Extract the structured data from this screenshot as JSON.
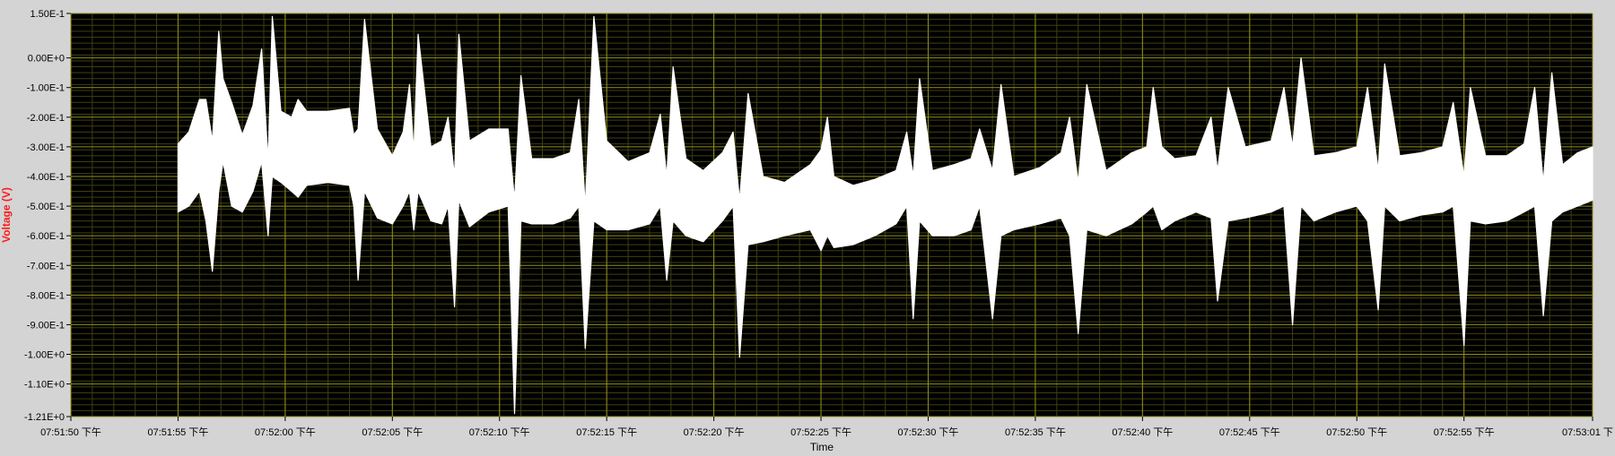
{
  "colors": {
    "background": "#d4d4d4",
    "plot_bg": "#000000",
    "major_grid": "#8f8f1e",
    "minor_grid": "#3f3f12",
    "trace": "#ffffff",
    "ylabel": "#ff1a1a",
    "tick_text": "#000000"
  },
  "chart_data": {
    "type": "line",
    "title": "",
    "xlabel": "Time",
    "ylabel": "Voltage (V)",
    "grid": true,
    "legend": "none",
    "xlim": [
      "07:51:50",
      "07:53:01"
    ],
    "ylim": [
      -1.21,
      0.15
    ],
    "xtick_labels": [
      "07:51:50 下午",
      "07:51:55 下午",
      "07:52:00 下午",
      "07:52:05 下午",
      "07:52:10 下午",
      "07:52:15 下午",
      "07:52:20 下午",
      "07:52:25 下午",
      "07:52:30 下午",
      "07:52:35 下午",
      "07:52:40 下午",
      "07:52:45 下午",
      "07:52:50 下午",
      "07:52:55 下午",
      "07:53:01 下"
    ],
    "ytick_labels": [
      "1.50E-1",
      "0.00E+0",
      "-1.00E-1",
      "-2.00E-1",
      "-3.00E-1",
      "-4.00E-1",
      "-5.00E-1",
      "-6.00E-1",
      "-7.00E-1",
      "-8.00E-1",
      "-9.00E-1",
      "-1.00E+0",
      "-1.10E+0",
      "-1.21E+0"
    ],
    "ytick_values": [
      0.15,
      0.0,
      -0.1,
      -0.2,
      -0.3,
      -0.4,
      -0.5,
      -0.6,
      -0.7,
      -0.8,
      -0.9,
      -1.0,
      -1.1,
      -1.21
    ],
    "series": [
      {
        "band": [
          {
            "t": "07:51:55.0",
            "lo": -0.52,
            "hi": -0.29
          },
          {
            "t": "07:51:55.5",
            "lo": -0.5,
            "hi": -0.25
          },
          {
            "t": "07:51:56.0",
            "lo": -0.45,
            "hi": -0.14
          },
          {
            "t": "07:51:56.3",
            "lo": -0.55,
            "hi": -0.14
          },
          {
            "t": "07:51:56.6",
            "lo": -0.72,
            "hi": -0.28
          },
          {
            "t": "07:51:56.9",
            "lo": -0.45,
            "hi": 0.09
          },
          {
            "t": "07:51:57.1",
            "lo": -0.35,
            "hi": -0.07
          },
          {
            "t": "07:51:57.5",
            "lo": -0.5,
            "hi": -0.15
          },
          {
            "t": "07:51:58.0",
            "lo": -0.52,
            "hi": -0.26
          },
          {
            "t": "07:51:58.5",
            "lo": -0.45,
            "hi": -0.16
          },
          {
            "t": "07:51:58.9",
            "lo": -0.35,
            "hi": 0.03
          },
          {
            "t": "07:51:59.2",
            "lo": -0.6,
            "hi": -0.35
          },
          {
            "t": "07:51:59.4",
            "lo": -0.4,
            "hi": 0.14
          },
          {
            "t": "07:51:59.8",
            "lo": -0.42,
            "hi": -0.18
          },
          {
            "t": "07:52:00.3",
            "lo": -0.45,
            "hi": -0.2
          },
          {
            "t": "07:52:00.6",
            "lo": -0.47,
            "hi": -0.14
          },
          {
            "t": "07:52:01.0",
            "lo": -0.43,
            "hi": -0.18
          },
          {
            "t": "07:52:02.0",
            "lo": -0.42,
            "hi": -0.18
          },
          {
            "t": "07:52:03.0",
            "lo": -0.43,
            "hi": -0.17
          },
          {
            "t": "07:52:03.2",
            "lo": -0.5,
            "hi": -0.26
          },
          {
            "t": "07:52:03.4",
            "lo": -0.75,
            "hi": -0.24
          },
          {
            "t": "07:52:03.7",
            "lo": -0.45,
            "hi": 0.13
          },
          {
            "t": "07:52:04.3",
            "lo": -0.54,
            "hi": -0.24
          },
          {
            "t": "07:52:05.0",
            "lo": -0.56,
            "hi": -0.33
          },
          {
            "t": "07:52:05.5",
            "lo": -0.5,
            "hi": -0.25
          },
          {
            "t": "07:52:05.8",
            "lo": -0.45,
            "hi": -0.09
          },
          {
            "t": "07:52:06.0",
            "lo": -0.58,
            "hi": -0.32
          },
          {
            "t": "07:52:06.2",
            "lo": -0.45,
            "hi": 0.08
          },
          {
            "t": "07:52:06.8",
            "lo": -0.55,
            "hi": -0.3
          },
          {
            "t": "07:52:07.3",
            "lo": -0.56,
            "hi": -0.28
          },
          {
            "t": "07:52:07.6",
            "lo": -0.5,
            "hi": -0.2
          },
          {
            "t": "07:52:07.9",
            "lo": -0.84,
            "hi": -0.4
          },
          {
            "t": "07:52:08.1",
            "lo": -0.48,
            "hi": 0.08
          },
          {
            "t": "07:52:08.6",
            "lo": -0.57,
            "hi": -0.28
          },
          {
            "t": "07:52:09.5",
            "lo": -0.52,
            "hi": -0.24
          },
          {
            "t": "07:52:10.4",
            "lo": -0.5,
            "hi": -0.24
          },
          {
            "t": "07:52:10.7",
            "lo": -1.2,
            "hi": -0.48
          },
          {
            "t": "07:52:11.0",
            "lo": -0.55,
            "hi": -0.06
          },
          {
            "t": "07:52:11.5",
            "lo": -0.56,
            "hi": -0.34
          },
          {
            "t": "07:52:12.5",
            "lo": -0.56,
            "hi": -0.34
          },
          {
            "t": "07:52:13.3",
            "lo": -0.54,
            "hi": -0.32
          },
          {
            "t": "07:52:13.7",
            "lo": -0.5,
            "hi": -0.14
          },
          {
            "t": "07:52:14.0",
            "lo": -0.98,
            "hi": -0.5
          },
          {
            "t": "07:52:14.4",
            "lo": -0.55,
            "hi": 0.14
          },
          {
            "t": "07:52:15.0",
            "lo": -0.58,
            "hi": -0.28
          },
          {
            "t": "07:52:16.0",
            "lo": -0.58,
            "hi": -0.35
          },
          {
            "t": "07:52:17.0",
            "lo": -0.56,
            "hi": -0.32
          },
          {
            "t": "07:52:17.5",
            "lo": -0.5,
            "hi": -0.19
          },
          {
            "t": "07:52:17.8",
            "lo": -0.75,
            "hi": -0.4
          },
          {
            "t": "07:52:18.1",
            "lo": -0.55,
            "hi": -0.03
          },
          {
            "t": "07:52:18.7",
            "lo": -0.6,
            "hi": -0.34
          },
          {
            "t": "07:52:19.5",
            "lo": -0.62,
            "hi": -0.38
          },
          {
            "t": "07:52:20.4",
            "lo": -0.55,
            "hi": -0.32
          },
          {
            "t": "07:52:20.9",
            "lo": -0.5,
            "hi": -0.25
          },
          {
            "t": "07:52:21.2",
            "lo": -1.01,
            "hi": -0.48
          },
          {
            "t": "07:52:21.6",
            "lo": -0.63,
            "hi": -0.12
          },
          {
            "t": "07:52:22.3",
            "lo": -0.62,
            "hi": -0.4
          },
          {
            "t": "07:52:23.3",
            "lo": -0.6,
            "hi": -0.42
          },
          {
            "t": "07:52:24.5",
            "lo": -0.58,
            "hi": -0.36
          },
          {
            "t": "07:52:25.0",
            "lo": -0.65,
            "hi": -0.31
          },
          {
            "t": "07:52:25.3",
            "lo": -0.6,
            "hi": -0.2
          },
          {
            "t": "07:52:25.6",
            "lo": -0.64,
            "hi": -0.4
          },
          {
            "t": "07:52:26.5",
            "lo": -0.63,
            "hi": -0.43
          },
          {
            "t": "07:52:27.5",
            "lo": -0.6,
            "hi": -0.41
          },
          {
            "t": "07:52:28.5",
            "lo": -0.56,
            "hi": -0.38
          },
          {
            "t": "07:52:29.0",
            "lo": -0.5,
            "hi": -0.25
          },
          {
            "t": "07:52:29.3",
            "lo": -0.88,
            "hi": -0.4
          },
          {
            "t": "07:52:29.6",
            "lo": -0.55,
            "hi": -0.07
          },
          {
            "t": "07:52:30.2",
            "lo": -0.6,
            "hi": -0.38
          },
          {
            "t": "07:52:31.2",
            "lo": -0.6,
            "hi": -0.36
          },
          {
            "t": "07:52:32.0",
            "lo": -0.58,
            "hi": -0.34
          },
          {
            "t": "07:52:32.4",
            "lo": -0.5,
            "hi": -0.24
          },
          {
            "t": "07:52:33.0",
            "lo": -0.88,
            "hi": -0.38
          },
          {
            "t": "07:52:33.4",
            "lo": -0.6,
            "hi": -0.09
          },
          {
            "t": "07:52:34.0",
            "lo": -0.58,
            "hi": -0.4
          },
          {
            "t": "07:52:35.2",
            "lo": -0.56,
            "hi": -0.37
          },
          {
            "t": "07:52:36.2",
            "lo": -0.54,
            "hi": -0.32
          },
          {
            "t": "07:52:36.6",
            "lo": -0.6,
            "hi": -0.2
          },
          {
            "t": "07:52:37.0",
            "lo": -0.93,
            "hi": -0.42
          },
          {
            "t": "07:52:37.4",
            "lo": -0.58,
            "hi": -0.09
          },
          {
            "t": "07:52:38.3",
            "lo": -0.6,
            "hi": -0.38
          },
          {
            "t": "07:52:39.5",
            "lo": -0.56,
            "hi": -0.32
          },
          {
            "t": "07:52:40.2",
            "lo": -0.52,
            "hi": -0.3
          },
          {
            "t": "07:52:40.5",
            "lo": -0.5,
            "hi": -0.1
          },
          {
            "t": "07:52:40.9",
            "lo": -0.58,
            "hi": -0.3
          },
          {
            "t": "07:52:41.5",
            "lo": -0.55,
            "hi": -0.34
          },
          {
            "t": "07:52:42.5",
            "lo": -0.52,
            "hi": -0.33
          },
          {
            "t": "07:52:43.2",
            "lo": -0.54,
            "hi": -0.2
          },
          {
            "t": "07:52:43.5",
            "lo": -0.82,
            "hi": -0.38
          },
          {
            "t": "07:52:44.0",
            "lo": -0.55,
            "hi": -0.1
          },
          {
            "t": "07:52:44.8",
            "lo": -0.54,
            "hi": -0.3
          },
          {
            "t": "07:52:46.0",
            "lo": -0.52,
            "hi": -0.28
          },
          {
            "t": "07:52:46.6",
            "lo": -0.5,
            "hi": -0.1
          },
          {
            "t": "07:52:47.0",
            "lo": -0.9,
            "hi": -0.3
          },
          {
            "t": "07:52:47.4",
            "lo": -0.5,
            "hi": 0.0
          },
          {
            "t": "07:52:48.0",
            "lo": -0.55,
            "hi": -0.33
          },
          {
            "t": "07:52:49.0",
            "lo": -0.52,
            "hi": -0.32
          },
          {
            "t": "07:52:50.0",
            "lo": -0.5,
            "hi": -0.3
          },
          {
            "t": "07:52:50.5",
            "lo": -0.55,
            "hi": -0.1
          },
          {
            "t": "07:52:51.0",
            "lo": -0.85,
            "hi": -0.38
          },
          {
            "t": "07:52:51.3",
            "lo": -0.5,
            "hi": -0.02
          },
          {
            "t": "07:52:52.0",
            "lo": -0.55,
            "hi": -0.33
          },
          {
            "t": "07:52:53.0",
            "lo": -0.53,
            "hi": -0.32
          },
          {
            "t": "07:52:54.0",
            "lo": -0.52,
            "hi": -0.3
          },
          {
            "t": "07:52:54.5",
            "lo": -0.5,
            "hi": -0.15
          },
          {
            "t": "07:52:55.0",
            "lo": -0.97,
            "hi": -0.4
          },
          {
            "t": "07:52:55.3",
            "lo": -0.55,
            "hi": -0.1
          },
          {
            "t": "07:52:56.0",
            "lo": -0.56,
            "hi": -0.33
          },
          {
            "t": "07:52:57.0",
            "lo": -0.55,
            "hi": -0.33
          },
          {
            "t": "07:52:57.8",
            "lo": -0.52,
            "hi": -0.29
          },
          {
            "t": "07:52:58.3",
            "lo": -0.5,
            "hi": -0.1
          },
          {
            "t": "07:52:58.7",
            "lo": -0.87,
            "hi": -0.42
          },
          {
            "t": "07:52:59.1",
            "lo": -0.55,
            "hi": -0.05
          },
          {
            "t": "07:52:59.6",
            "lo": -0.52,
            "hi": -0.36
          },
          {
            "t": "07:53:00.3",
            "lo": -0.5,
            "hi": -0.32
          },
          {
            "t": "07:53:01.0",
            "lo": -0.48,
            "hi": -0.3
          }
        ]
      }
    ]
  }
}
